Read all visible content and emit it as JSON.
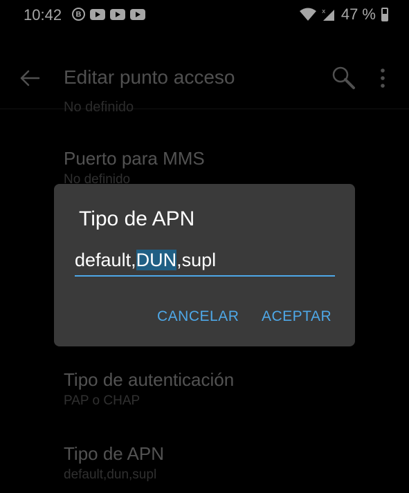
{
  "status_bar": {
    "time": "10:42",
    "icons": [
      "b-circle-icon",
      "youtube-icon",
      "youtube-icon",
      "youtube-icon",
      "wifi-icon",
      "signal-icon"
    ],
    "battery_text": "47 %"
  },
  "app_bar": {
    "title": "Editar punto acceso"
  },
  "list": {
    "ghost_subtitle": "No definido",
    "items": [
      {
        "title": "Puerto para MMS",
        "subtitle": "No definido"
      },
      {
        "title": "Tipo de autenticación",
        "subtitle": "PAP o CHAP"
      },
      {
        "title": "Tipo de APN",
        "subtitle": "default,dun,supl"
      }
    ]
  },
  "dialog": {
    "title": "Tipo de APN",
    "value_before": "default,",
    "value_selected": "DUN",
    "value_after": ",supl",
    "cancel_label": "CANCELAR",
    "accept_label": "ACEPTAR"
  },
  "colors": {
    "accent": "#4ea8e8",
    "dialog_bg": "#3a3a3a",
    "selection": "#1f5f84"
  }
}
